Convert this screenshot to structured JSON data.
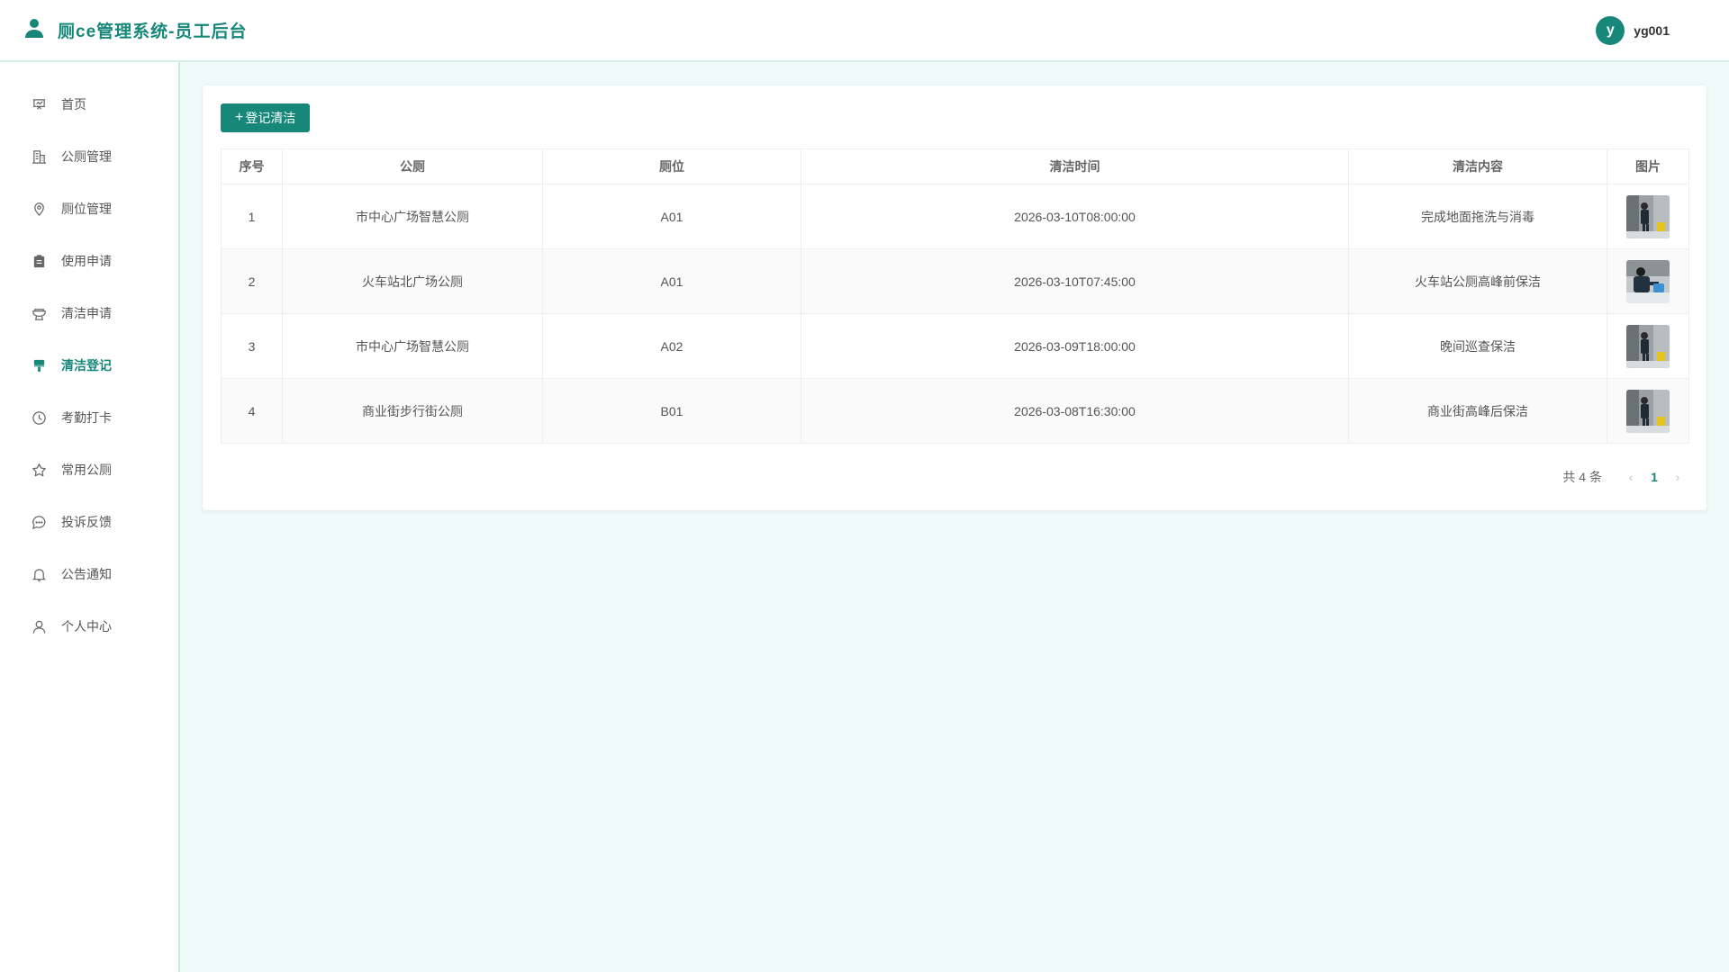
{
  "header": {
    "title": "厕ce管理系统-员工后台",
    "avatar_letter": "y",
    "username": "yg001",
    "accent_color": "#17877a"
  },
  "sidebar": {
    "items": [
      {
        "label": "首页",
        "icon": "presentation-icon"
      },
      {
        "label": "公厕管理",
        "icon": "building-icon"
      },
      {
        "label": "厕位管理",
        "icon": "location-pin-icon"
      },
      {
        "label": "使用申请",
        "icon": "clipboard-icon"
      },
      {
        "label": "清洁申请",
        "icon": "toilet-icon"
      },
      {
        "label": "清洁登记",
        "icon": "brush-icon",
        "active": true
      },
      {
        "label": "考勤打卡",
        "icon": "clock-icon"
      },
      {
        "label": "常用公厕",
        "icon": "star-icon"
      },
      {
        "label": "投诉反馈",
        "icon": "chat-icon"
      },
      {
        "label": "公告通知",
        "icon": "bell-icon"
      },
      {
        "label": "个人中心",
        "icon": "user-icon"
      }
    ]
  },
  "main": {
    "add_button_label": "登记清洁",
    "table": {
      "headers": [
        "序号",
        "公厕",
        "厕位",
        "清洁时间",
        "清洁内容",
        "图片"
      ],
      "rows": [
        {
          "index": "1",
          "toilet": "市中心广场智慧公厕",
          "stall": "A01",
          "time": "2026-03-10T08:00:00",
          "content": "完成地面拖洗与消毒"
        },
        {
          "index": "2",
          "toilet": "火车站北广场公厕",
          "stall": "A01",
          "time": "2026-03-10T07:45:00",
          "content": "火车站公厕高峰前保洁"
        },
        {
          "index": "3",
          "toilet": "市中心广场智慧公厕",
          "stall": "A02",
          "time": "2026-03-09T18:00:00",
          "content": "晚间巡查保洁"
        },
        {
          "index": "4",
          "toilet": "商业街步行街公厕",
          "stall": "B01",
          "time": "2026-03-08T16:30:00",
          "content": "商业街高峰后保洁"
        }
      ]
    },
    "pagination": {
      "total_text": "共 4 条",
      "current_page": "1"
    }
  }
}
